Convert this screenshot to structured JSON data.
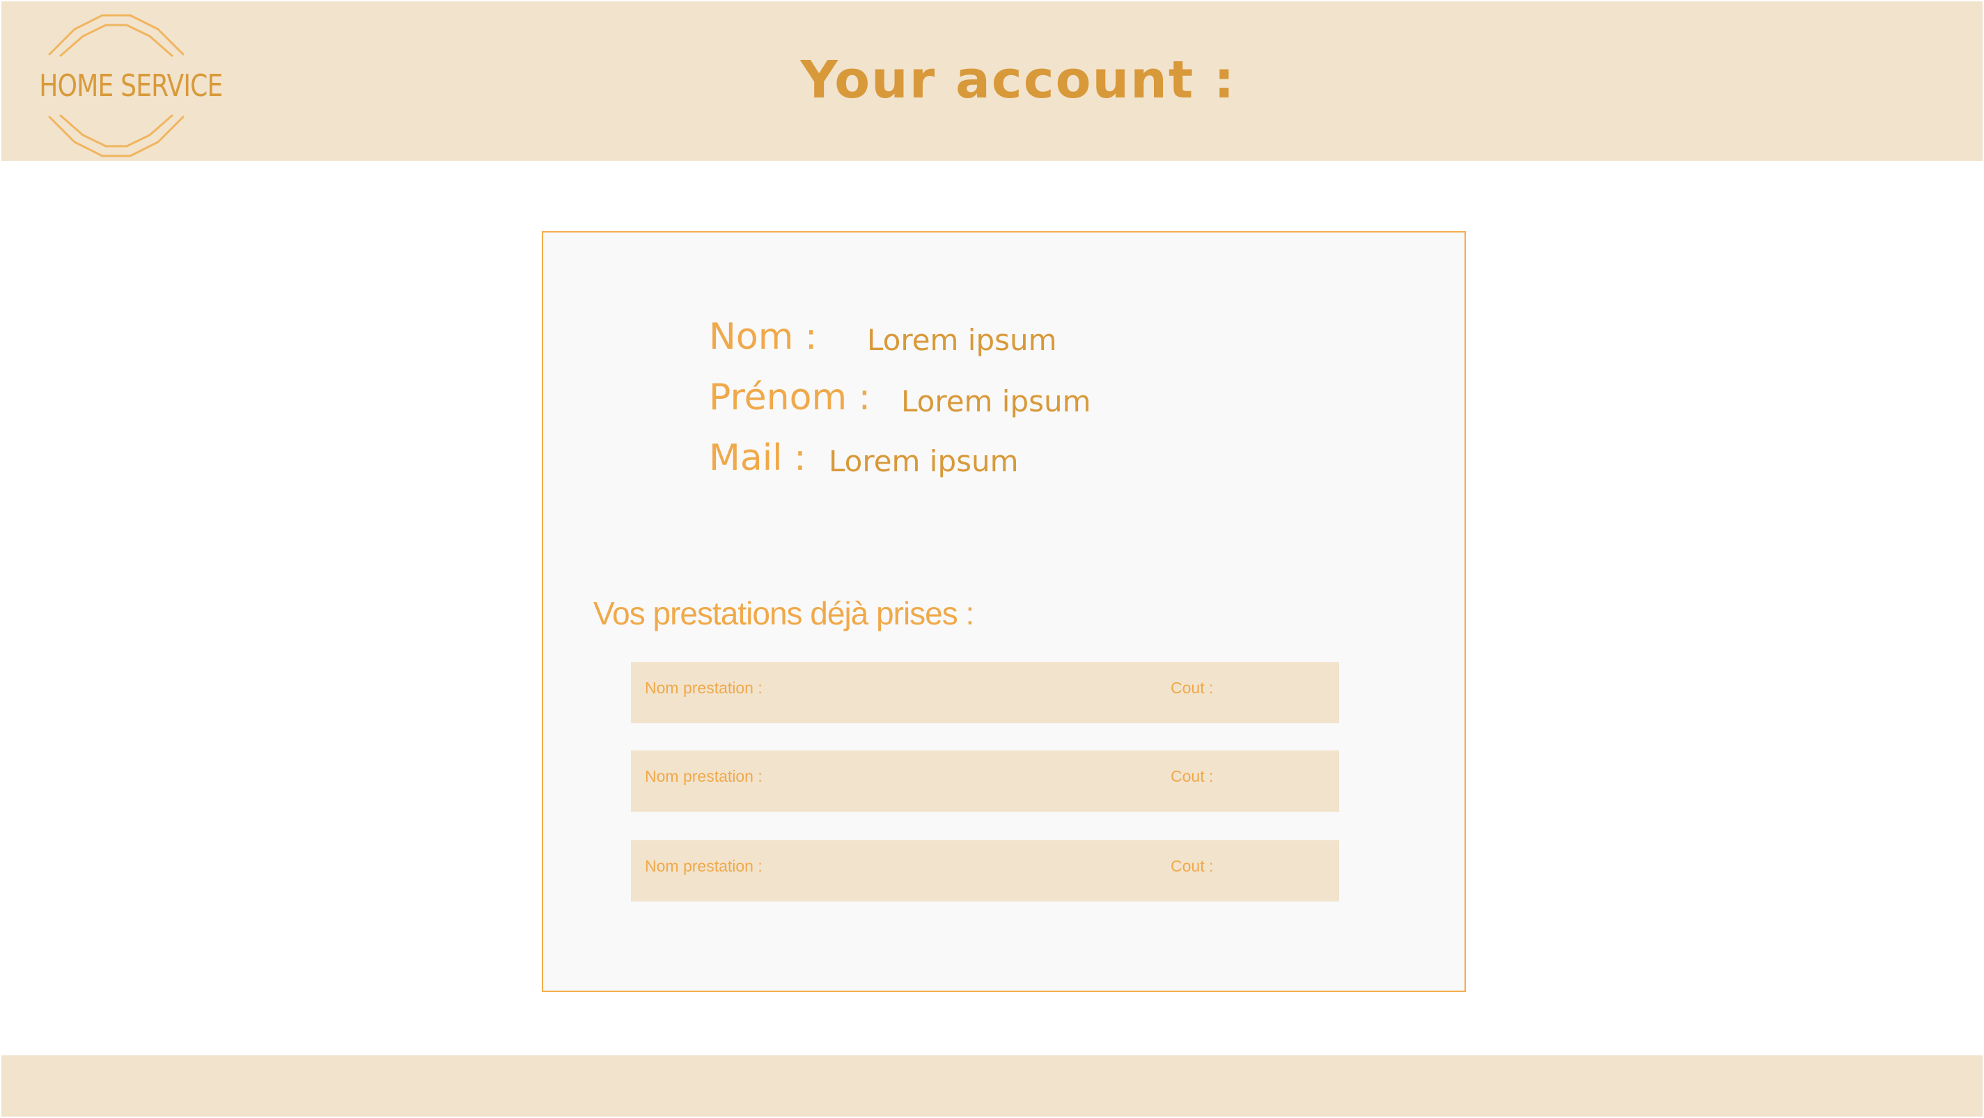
{
  "header": {
    "logo_text": "HOME SERVICE",
    "title": "Your account :"
  },
  "account": {
    "fields": [
      {
        "label": "Nom :",
        "value": "Lorem ipsum"
      },
      {
        "label": "Prénom :",
        "value": "Lorem ipsum"
      },
      {
        "label": "Mail :",
        "value": "Lorem ipsum"
      }
    ]
  },
  "services": {
    "title": "Vos prestations déjà prises :",
    "rows": [
      {
        "name_label": "Nom prestation :",
        "cost_label": "Cout :"
      },
      {
        "name_label": "Nom prestation :",
        "cost_label": "Cout :"
      },
      {
        "name_label": "Nom prestation :",
        "cost_label": "Cout :"
      }
    ]
  },
  "colors": {
    "header_bg": "#f2e3cd",
    "accent": "#f0a94a",
    "accent_dark": "#d8993a",
    "card_bg": "#f9f9f9",
    "card_border": "#f4ae4e"
  }
}
